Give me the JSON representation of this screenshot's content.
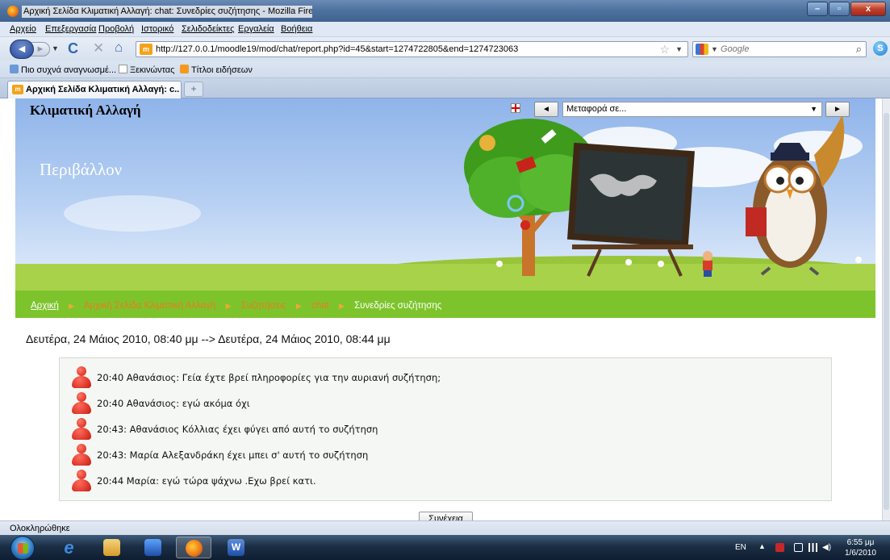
{
  "window": {
    "title": "Αρχική Σελίδα Κλιματική Αλλαγή: chat: Συνεδρίες συζήτησης - Mozilla Firefox",
    "minimize": "–",
    "maximize": "▫",
    "close": "x"
  },
  "menu": {
    "items": [
      "Αρχείο",
      "Επεξεργασία",
      "Προβολή",
      "Ιστορικό",
      "Σελιδοδείκτες",
      "Εργαλεία",
      "Βοήθεια"
    ]
  },
  "nav": {
    "url": "http://127.0.0.1/moodle19/mod/chat/report.php?id=45&start=1274722805&end=1274723063",
    "search_placeholder": "Google"
  },
  "bookmarks": {
    "items": [
      "Πιο συχνά αναγνωσμέ...",
      "Ξεκινώντας",
      "Τίτλοι ειδήσεων"
    ]
  },
  "tabs": {
    "active_label": "Αρχική Σελίδα Κλιματική Αλλαγή: c...",
    "new_tab": "+"
  },
  "page": {
    "site_title": "Κλιματική Αλλαγή",
    "subtitle": "Περιβάλλον",
    "jump": {
      "prev": "◄",
      "select_value": "Μεταφορά σε...",
      "next": "►"
    },
    "breadcrumb": [
      "Αρχική",
      "Αρχική Σελίδα Κλιματική Αλλαγή",
      "Συζητήσεις",
      "chat",
      "Συνεδρίες συζήτησης"
    ],
    "session_heading": "Δευτέρα, 24 Μάιος 2010, 08:40 μμ --> Δευτέρα, 24 Μάιος 2010, 08:44 μμ",
    "messages": [
      "20:40 Αθανάσιος: Γεία έχτε βρεί πληροφορίες για την αυριανή συζήτηση;",
      "20:40 Αθανάσιος: εγώ ακόμα όχι",
      "20:43: Αθανάσιος Κόλλιας έχει φύγει από αυτή το συζήτηση",
      "20:43: Μαρία Αλεξανδράκη έχει μπει σ' αυτή το συζήτηση",
      "20:44 Μαρία: εγώ τώρα ψάχνω .Εχω βρεί κατι."
    ],
    "continue_label": "Συνέχεια"
  },
  "status": {
    "text": "Ολοκληρώθηκε"
  },
  "taskbar": {
    "lang": "EN",
    "time": "6:55 μμ",
    "date": "1/6/2010"
  },
  "colors": {
    "nav_green": "#7dc42c",
    "crumb_orange": "#e67d1e",
    "avatar_red": "#d21d10"
  }
}
